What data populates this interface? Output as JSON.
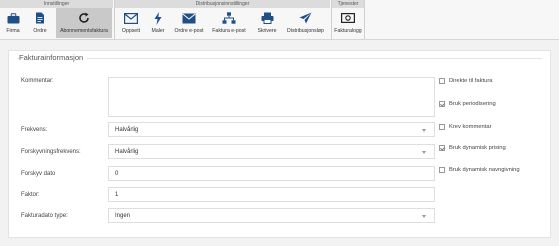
{
  "ribbon": {
    "groups": {
      "innstillinger": "Innstillinger",
      "distribusjon": "Distribusjonsinnstillinger",
      "tjenester": "Tjenester"
    },
    "buttons": {
      "firma": "Firma",
      "ordre": "Ordre",
      "abonnement": "Abonnementsfaktura",
      "oppsett": "Oppsett",
      "maler": "Maler",
      "ordre_epost": "Ordre e-post",
      "faktura_epost": "Faktura e-post",
      "skrivere": "Skrivere",
      "distribusjon": "Distribusjonsløp",
      "fakturalogg": "Fakturalogg"
    }
  },
  "section": {
    "title": "Fakturainformasjon"
  },
  "form": {
    "kommentar": {
      "label": "Kommentar:",
      "value": ""
    },
    "frekvens": {
      "label": "Frekvens:",
      "value": "Halvårlig"
    },
    "forskyvningsfrekvens": {
      "label": "Forskyvningsfrekvens:",
      "value": "Halvårlig"
    },
    "forskyv_dato": {
      "label": "Forskyv dato",
      "value": "0"
    },
    "faktor": {
      "label": "Faktor:",
      "value": "1"
    },
    "fakturadato_type": {
      "label": "Fakturadato type:",
      "value": "Ingen"
    }
  },
  "options": [
    {
      "label": "Direkte til faktura",
      "checked": false
    },
    {
      "label": "Bruk periodisering",
      "checked": true
    },
    {
      "label": "Krev kommentar",
      "checked": false
    },
    {
      "label": "Bruk dynamisk prising",
      "checked": true
    },
    {
      "label": "Bruk dynamisk navngivning",
      "checked": false
    }
  ]
}
